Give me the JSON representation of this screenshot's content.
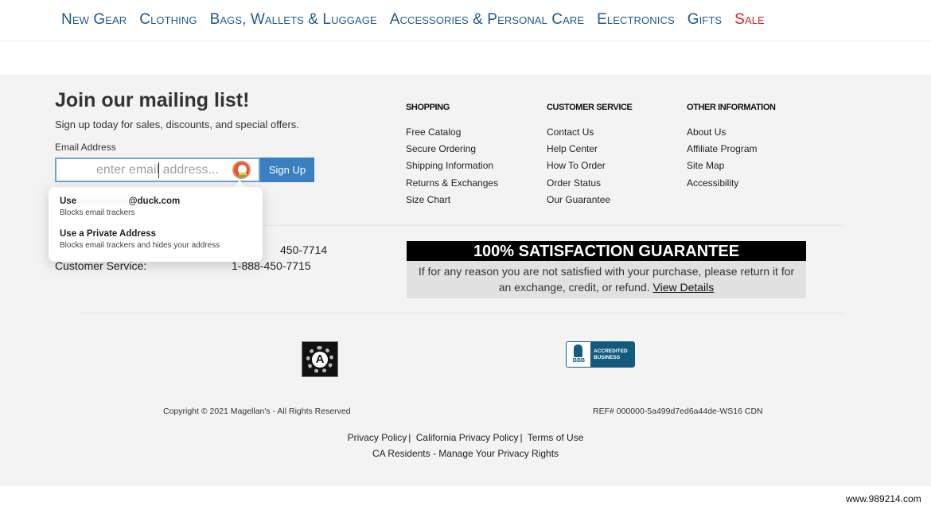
{
  "nav": {
    "items": [
      {
        "label": "New Gear"
      },
      {
        "label": "Clothing"
      },
      {
        "label": "Bags, Wallets & Luggage"
      },
      {
        "label": "Accessories & Personal Care"
      },
      {
        "label": "Electronics"
      },
      {
        "label": "Gifts"
      },
      {
        "label": "Sale"
      }
    ]
  },
  "mailing": {
    "title": "Join our mailing list!",
    "subtitle": "Sign up today for sales, discounts, and special offers.",
    "email_label": "Email Address",
    "email_value": "",
    "email_placeholder": "enter email address...",
    "signup_label": "Sign Up"
  },
  "autofill_popup": {
    "option1_prefix": "Use",
    "option1_suffix": "@duck.com",
    "option1_sub": "Blocks email trackers",
    "option2_title": "Use a Private Address",
    "option2_sub": "Blocks email trackers and hides your address"
  },
  "phones": {
    "line1_number_visible": "450-7714",
    "line2_label": "Customer Service:",
    "line2_number": "1-888-450-7715"
  },
  "columns": [
    {
      "heading": "SHOPPING",
      "links": [
        "Free Catalog",
        "Secure Ordering",
        "Shipping Information",
        "Returns & Exchanges",
        "Size Chart"
      ]
    },
    {
      "heading": "CUSTOMER SERVICE",
      "links": [
        "Contact Us",
        "Help Center",
        "How To Order",
        "Order Status",
        "Our Guarantee"
      ]
    },
    {
      "heading": "OTHER INFORMATION",
      "links": [
        "About Us",
        "Affiliate Program",
        "Site Map",
        "Accessibility"
      ]
    }
  ],
  "guarantee": {
    "title": "100% SATISFACTION GUARANTEE",
    "body": "If for any reason you are not satisfied with your purchase, please return it for an exchange, credit, or refund.",
    "link": "View Details"
  },
  "badges": {
    "ada_glyph": "A",
    "bbb_logo": "BBB",
    "bbb_line1": "ACCREDITED",
    "bbb_line2": "BUSINESS"
  },
  "footer": {
    "copyright": "Copyright © 2021 Magellan's - All Rights Reserved",
    "ref": "REF# 000000-5a499d7ed6a44de-WS16 CDN",
    "legal_links": [
      "Privacy Policy",
      "California Privacy Policy",
      "Terms of Use"
    ],
    "legal_sep": "|",
    "ca_link": "CA Residents - Manage Your Privacy Rights"
  },
  "watermark": "www.989214.com"
}
